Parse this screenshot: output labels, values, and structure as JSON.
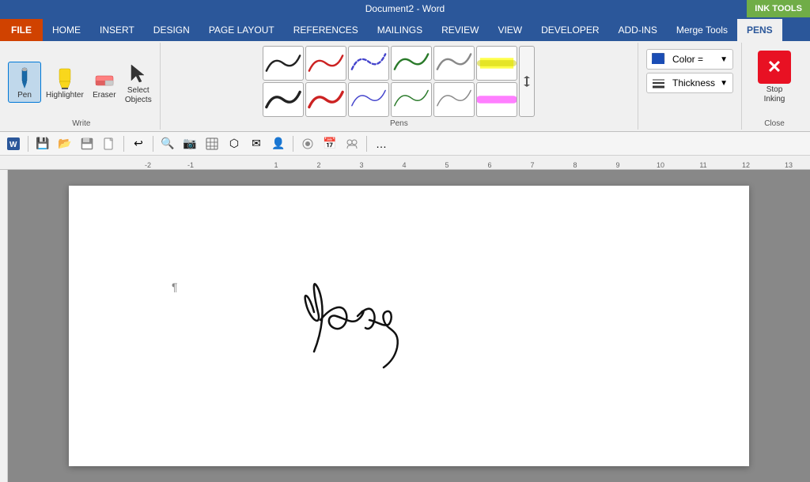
{
  "titlebar": {
    "title": "Document2 - Word",
    "ink_tools_label": "INK TOOLS"
  },
  "tabs": [
    {
      "label": "FILE",
      "type": "file"
    },
    {
      "label": "HOME",
      "type": "normal"
    },
    {
      "label": "INSERT",
      "type": "normal"
    },
    {
      "label": "DESIGN",
      "type": "normal"
    },
    {
      "label": "PAGE LAYOUT",
      "type": "normal"
    },
    {
      "label": "REFERENCES",
      "type": "normal"
    },
    {
      "label": "MAILINGS",
      "type": "normal"
    },
    {
      "label": "REVIEW",
      "type": "normal"
    },
    {
      "label": "VIEW",
      "type": "normal"
    },
    {
      "label": "DEVELOPER",
      "type": "normal"
    },
    {
      "label": "ADD-INS",
      "type": "normal"
    },
    {
      "label": "Merge Tools",
      "type": "normal"
    },
    {
      "label": "PENS",
      "type": "active"
    }
  ],
  "write_group": {
    "label": "Write",
    "tools": [
      {
        "id": "pen",
        "label": "Pen",
        "active": true
      },
      {
        "id": "highlighter",
        "label": "Highlighter",
        "active": false
      },
      {
        "id": "eraser",
        "label": "Eraser",
        "active": false
      },
      {
        "id": "select",
        "label": "Select\nObjects",
        "active": false
      }
    ]
  },
  "pens_group": {
    "label": "Pens"
  },
  "color_label": "Color =",
  "thickness_label": "Thickness",
  "stop_inking_label": "Stop\nInking",
  "close_label": "Close",
  "ruler_marks": [
    "-2",
    "-1",
    "",
    "1",
    "2",
    "3",
    "4",
    "5",
    "6",
    "7",
    "8",
    "9",
    "10",
    "11",
    "12",
    "13"
  ]
}
